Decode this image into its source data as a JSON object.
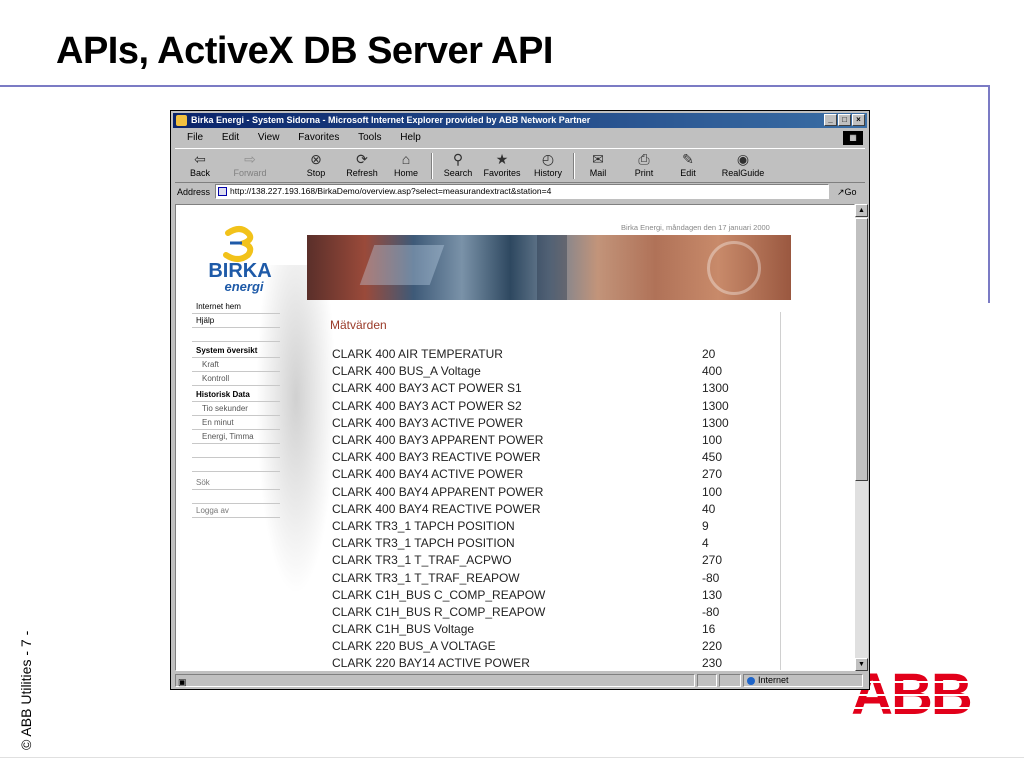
{
  "slide": {
    "title": "APIs, ActiveX DB Server API",
    "side_caption": "© ABB Utilities  - 7 -",
    "logo_text": "ABB"
  },
  "browser": {
    "title": "Birka Energi - System Sidorna - Microsoft Internet Explorer provided by ABB Network Partner",
    "menu": [
      "File",
      "Edit",
      "View",
      "Favorites",
      "Tools",
      "Help"
    ],
    "toolbar": {
      "back": "Back",
      "forward": "Forward",
      "stop": "Stop",
      "refresh": "Refresh",
      "home": "Home",
      "search": "Search",
      "favorites": "Favorites",
      "history": "History",
      "mail": "Mail",
      "print": "Print",
      "edit": "Edit",
      "realguide": "RealGuide"
    },
    "address_label": "Address",
    "address": "http://138.227.193.168/BirkaDemo/overview.asp?select=measurandextract&station=4",
    "go": "Go",
    "status_zone": "Internet"
  },
  "page": {
    "date": "Birka Energi, måndagen den 17 januari 2000",
    "logo": {
      "line1": "BIRKA",
      "line2": "energi"
    },
    "nav": [
      {
        "label": "Internet hem",
        "style": "plain"
      },
      {
        "label": "Hjälp",
        "style": "plain"
      },
      {
        "label": "",
        "style": "gap"
      },
      {
        "label": "System översikt",
        "style": "bold"
      },
      {
        "label": "Kraft",
        "style": "sub"
      },
      {
        "label": "Kontroll",
        "style": "sub"
      },
      {
        "label": "Historisk Data",
        "style": "bold"
      },
      {
        "label": "Tio sekunder",
        "style": "sub"
      },
      {
        "label": "En minut",
        "style": "sub"
      },
      {
        "label": "Energi, Timma",
        "style": "sub"
      },
      {
        "label": "",
        "style": "gap"
      },
      {
        "label": "",
        "style": "gap"
      },
      {
        "label": "Sök",
        "style": "muted"
      },
      {
        "label": "",
        "style": "gap"
      },
      {
        "label": "Logga av",
        "style": "muted"
      }
    ],
    "section_title": "Mätvärden",
    "measurements": [
      {
        "name": "CLARK 400 AIR TEMPERATUR",
        "value": "20"
      },
      {
        "name": "CLARK 400 BUS_A Voltage",
        "value": "400"
      },
      {
        "name": "CLARK 400 BAY3 ACT POWER S1",
        "value": "1300"
      },
      {
        "name": "CLARK 400 BAY3 ACT POWER S2",
        "value": "1300"
      },
      {
        "name": "CLARK 400 BAY3 ACTIVE POWER",
        "value": "1300"
      },
      {
        "name": "CLARK 400 BAY3 APPARENT POWER",
        "value": "100"
      },
      {
        "name": "CLARK 400 BAY3 REACTIVE POWER",
        "value": "450"
      },
      {
        "name": "CLARK 400 BAY4 ACTIVE POWER",
        "value": "270"
      },
      {
        "name": "CLARK 400 BAY4 APPARENT POWER",
        "value": "100"
      },
      {
        "name": "CLARK 400 BAY4 REACTIVE POWER",
        "value": "40"
      },
      {
        "name": "CLARK TR3_1 TAPCH POSITION",
        "value": "9"
      },
      {
        "name": "CLARK TR3_1 TAPCH POSITION",
        "value": "4"
      },
      {
        "name": "CLARK TR3_1 T_TRAF_ACPWO",
        "value": "270"
      },
      {
        "name": "CLARK TR3_1 T_TRAF_REAPOW",
        "value": "-80"
      },
      {
        "name": "CLARK C1H_BUS C_COMP_REAPOW",
        "value": "130"
      },
      {
        "name": "CLARK C1H_BUS R_COMP_REAPOW",
        "value": "-80"
      },
      {
        "name": "CLARK C1H_BUS Voltage",
        "value": "16"
      },
      {
        "name": "CLARK 220 BUS_A VOLTAGE",
        "value": "220"
      },
      {
        "name": "CLARK 220 BAY14 ACTIVE POWER",
        "value": "230"
      }
    ]
  },
  "colors": {
    "rule": "#7b7bc4",
    "titlebar": "#0a246a",
    "abb_red": "#e2001a",
    "birka_blue": "#1e5aa8",
    "birka_yellow": "#f2c21a",
    "section_title": "#9a3a28"
  }
}
